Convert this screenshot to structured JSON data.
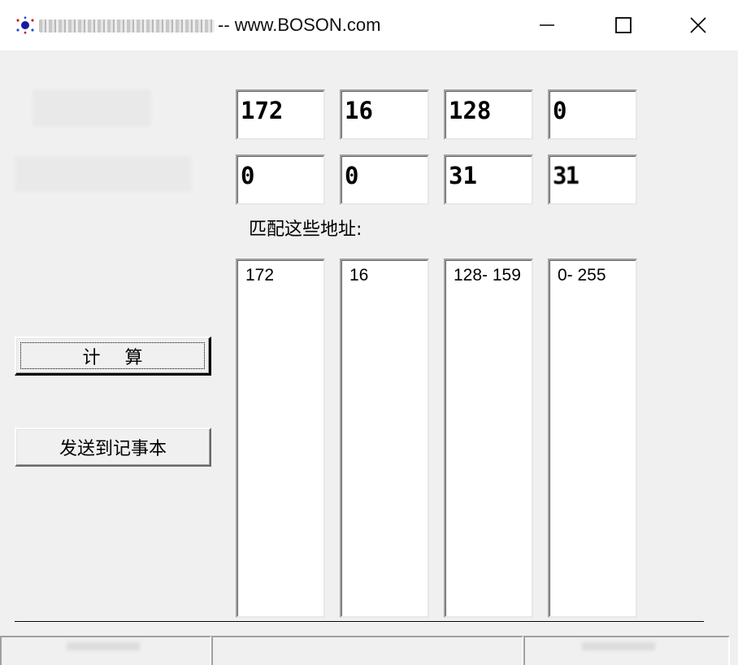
{
  "window": {
    "title_suffix": "-- www.BOSON.com",
    "controls": {
      "minimize": "minimize-icon",
      "maximize": "maximize-icon",
      "close": "close-icon"
    }
  },
  "inputs": {
    "row1": [
      "172",
      "16",
      "128",
      "0"
    ],
    "row2": [
      "0",
      "0",
      "31",
      "31"
    ]
  },
  "match": {
    "label": "匹配这些地址:",
    "lists": [
      "172",
      "16",
      "128- 159",
      "0- 255"
    ]
  },
  "buttons": {
    "calculate": "计算",
    "send_to_notepad": "发送到记事本"
  },
  "colors": {
    "window_bg": "#f0f0f0",
    "titlebar_bg": "#ffffff",
    "field_bg": "#ffffff",
    "icon_accent": "#1a1aa0"
  }
}
